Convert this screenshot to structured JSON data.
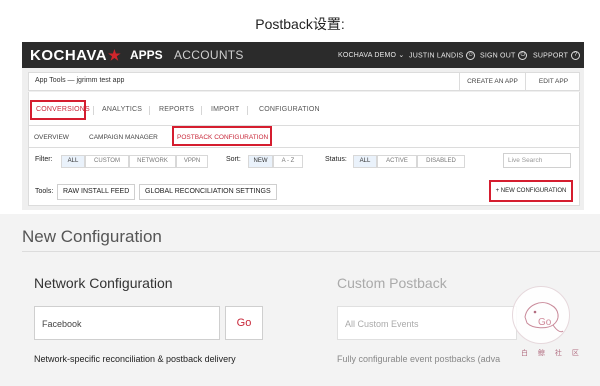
{
  "page_title": "Postback设置:",
  "topbar": {
    "logo": "KOCHAVA",
    "apps": "APPS",
    "accounts": "ACCOUNTS",
    "account_menu": "KOCHAVA DEMO",
    "user": "JUSTIN LANDIS",
    "sign_out": "SIGN OUT",
    "support": "SUPPORT",
    "colors": {
      "bg": "#2b2b2b",
      "accent": "#d0262c"
    }
  },
  "subbar": {
    "title": "App Tools — jgrimm test app",
    "create_app": "CREATE AN APP",
    "edit_app": "EDIT APP"
  },
  "tabs": [
    "CONVERSIONS",
    "ANALYTICS",
    "REPORTS",
    "IMPORT",
    "CONFIGURATION"
  ],
  "subtabs": [
    "OVERVIEW",
    "CAMPAIGN MANAGER",
    "POSTBACK CONFIGURATION"
  ],
  "filters": {
    "filter_label": "Filter:",
    "filter_opts": [
      "ALL",
      "CUSTOM",
      "NETWORK",
      "VPPN"
    ],
    "sort_label": "Sort:",
    "sort_opts": [
      "NEW",
      "A - Z"
    ],
    "status_label": "Status:",
    "status_opts": [
      "ALL",
      "ACTIVE",
      "DISABLED"
    ],
    "search_placeholder": "Live Search"
  },
  "tools": {
    "label": "Tools:",
    "raw": "RAW INSTALL FEED",
    "global": "GLOBAL RECONCILIATION SETTINGS",
    "new_config": "+ NEW CONFIGURATION"
  },
  "new_configuration": {
    "title": "New Configuration",
    "network_title": "Network Configuration",
    "network_value": "Facebook",
    "go": "Go",
    "network_desc": "Network-specific reconciliation & postback delivery",
    "custom_title": "Custom Postback",
    "custom_value": "All Custom Events",
    "custom_desc": "Fully configurable event postbacks (adva"
  },
  "watermark": {
    "go": "Go",
    "text": "白 鲸 社 区"
  }
}
